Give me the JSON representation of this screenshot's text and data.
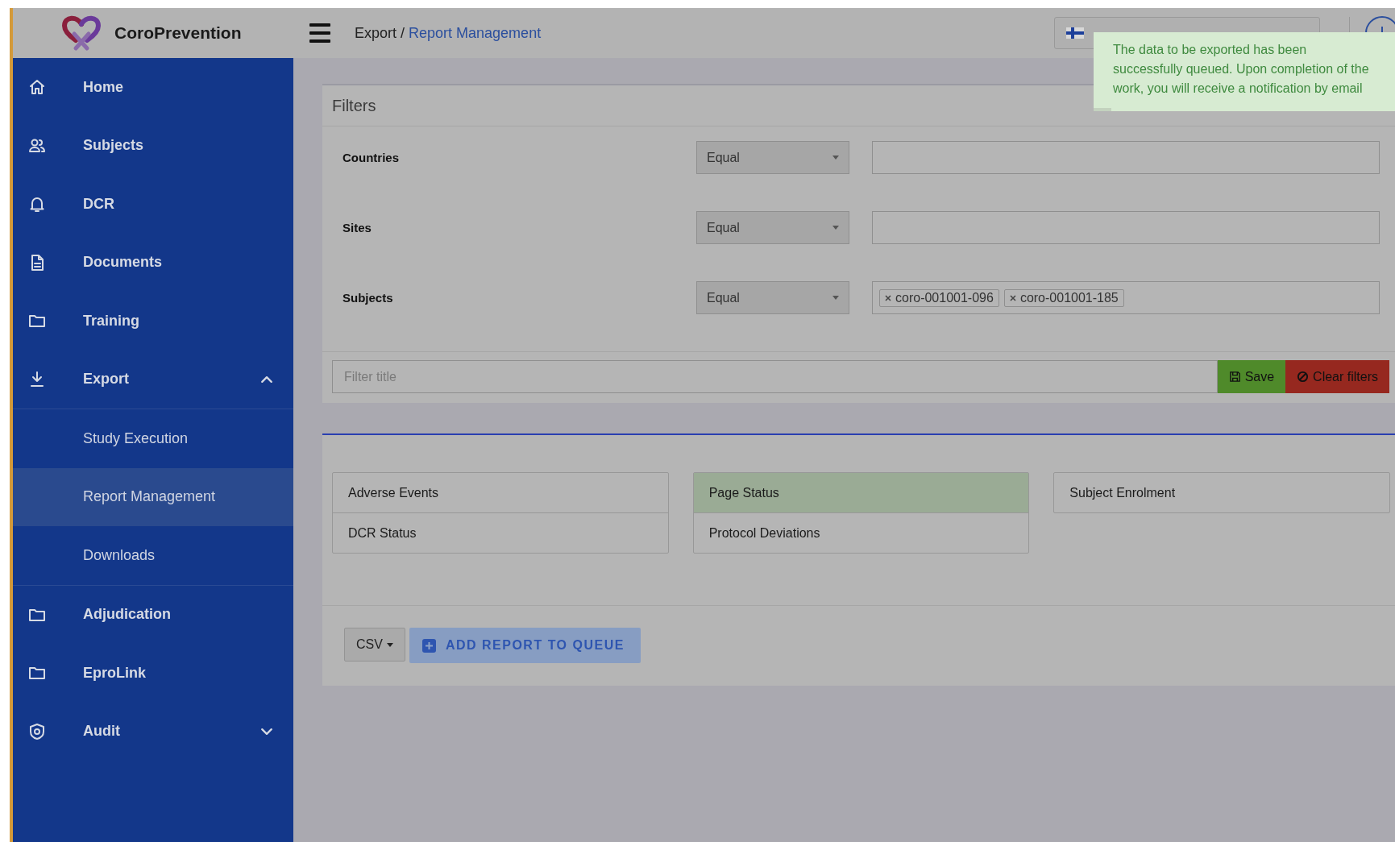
{
  "header": {
    "brand": "CoroPrevention",
    "breadcrumb": {
      "parent": "Export",
      "separator": "/",
      "current": "Report Management"
    }
  },
  "sidebar": {
    "items": [
      {
        "label": "Home",
        "selected": false
      },
      {
        "label": "Subjects",
        "selected": false
      },
      {
        "label": "DCR",
        "selected": false
      },
      {
        "label": "Documents",
        "selected": false
      },
      {
        "label": "Training",
        "selected": false
      },
      {
        "label": "Export",
        "selected": false,
        "kind": "group",
        "expanded": true,
        "children": [
          {
            "label": "Study Execution",
            "selected": false
          },
          {
            "label": "Report Management",
            "selected": true
          },
          {
            "label": "Downloads",
            "selected": false
          }
        ]
      },
      {
        "label": "Adjudication",
        "selected": false
      },
      {
        "label": "EproLink",
        "selected": false
      },
      {
        "label": "Audit",
        "selected": false,
        "kind": "group",
        "expanded": false
      }
    ]
  },
  "filters": {
    "title": "Filters",
    "rows": [
      {
        "label": "Countries",
        "operator": "Equal",
        "values": []
      },
      {
        "label": "Sites",
        "operator": "Equal",
        "values": []
      },
      {
        "label": "Subjects",
        "operator": "Equal",
        "values": [
          "coro-001001-096",
          "coro-001001-185"
        ]
      }
    ],
    "filter_title": {
      "placeholder": "Filter title"
    },
    "buttons": {
      "save": "Save",
      "clear": "Clear filters"
    }
  },
  "reports": {
    "columns": [
      [
        {
          "label": "Adverse Events",
          "selected": false
        },
        {
          "label": "DCR Status",
          "selected": false
        }
      ],
      [
        {
          "label": "Page Status",
          "selected": true
        },
        {
          "label": "Protocol Deviations",
          "selected": false
        }
      ],
      [
        {
          "label": "Subject Enrolment",
          "selected": false
        }
      ]
    ],
    "format": "CSV",
    "add_button": "ADD REPORT TO QUEUE"
  },
  "toast": {
    "message": "The data to be exported has been successfully queued. Upon completion of the work, you will receive a notification by email",
    "progress": {
      "level": 0.06
    }
  }
}
